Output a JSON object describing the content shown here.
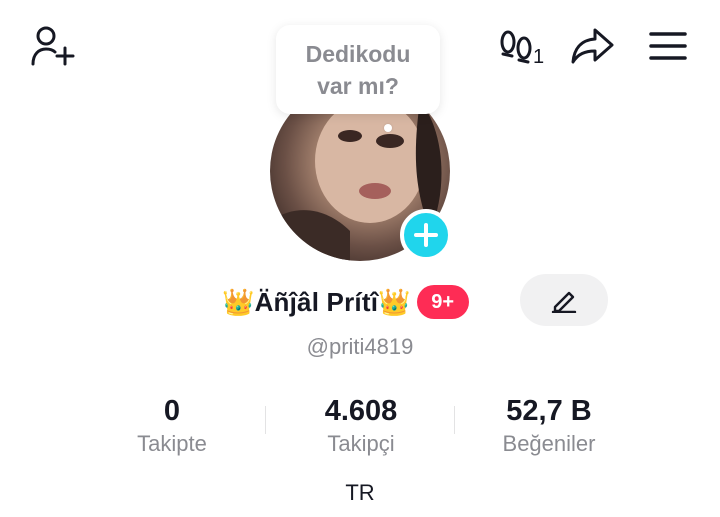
{
  "header": {
    "footprint_count": "1",
    "bubble_line1": "Dedikodu",
    "bubble_line2": "var mı?"
  },
  "profile": {
    "display_name": "👑Äñĵâl Prítî👑",
    "badge": "9+",
    "username": "@priti4819",
    "bio": "TR"
  },
  "stats": [
    {
      "value": "0",
      "label": "Takipte"
    },
    {
      "value": "4.608",
      "label": "Takipçi"
    },
    {
      "value": "52,7 B",
      "label": "Beğeniler"
    }
  ],
  "icons": {
    "add_friend": "add-user-icon",
    "footprint": "footprint-icon",
    "share": "share-arrow-icon",
    "menu": "hamburger-menu-icon",
    "edit": "pencil-icon",
    "avatar_add": "plus-icon"
  },
  "colors": {
    "accent_cyan": "#20d5ec",
    "badge_red": "#fe2c55",
    "secondary_text": "#8a8b91",
    "primary_text": "#161823"
  }
}
